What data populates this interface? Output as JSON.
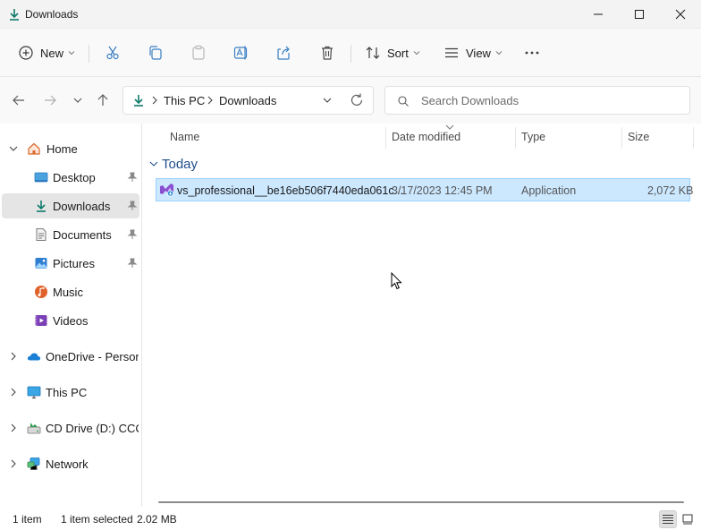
{
  "window": {
    "title": "Downloads",
    "controls": [
      "minimize-icon",
      "maximize-icon",
      "close-icon"
    ]
  },
  "toolbar": {
    "new_label": "New",
    "sort_label": "Sort",
    "view_label": "View",
    "icons": [
      "plus-circle-icon",
      "cut-icon",
      "copy-icon",
      "paste-icon",
      "rename-icon",
      "share-icon",
      "delete-icon",
      "sort-icon",
      "view-icon",
      "more-icon"
    ],
    "accent_color": "#0f7b6c"
  },
  "address": {
    "crumbs": [
      "This PC",
      "Downloads"
    ],
    "search_placeholder": "Search Downloads"
  },
  "sidebar": {
    "items": [
      {
        "label": "Home",
        "icon": "home-icon"
      },
      {
        "label": "Desktop",
        "icon": "desktop-icon"
      },
      {
        "label": "Downloads",
        "icon": "download-icon"
      },
      {
        "label": "Documents",
        "icon": "documents-icon"
      },
      {
        "label": "Pictures",
        "icon": "pictures-icon"
      },
      {
        "label": "Music",
        "icon": "music-icon"
      },
      {
        "label": "Videos",
        "icon": "videos-icon"
      },
      {
        "label": "OneDrive - Personal",
        "icon": "onedrive-icon"
      },
      {
        "label": "This PC",
        "icon": "monitor-icon"
      },
      {
        "label": "CD Drive (D:) CCCO",
        "icon": "cd-drive-icon"
      },
      {
        "label": "Network",
        "icon": "network-icon"
      }
    ],
    "selected": "Downloads"
  },
  "list": {
    "columns": [
      "Name",
      "Date modified",
      "Type",
      "Size"
    ],
    "group": "Today",
    "rows": [
      {
        "name": "vs_professional__be16eb506f7440eda061c...",
        "date": "3/17/2023 12:45 PM",
        "type": "Application",
        "size": "2,072 KB"
      }
    ],
    "selection_color": "#cce8ff"
  },
  "status": {
    "items": "1 item",
    "selected": "1 item selected",
    "size": "2.02 MB"
  }
}
